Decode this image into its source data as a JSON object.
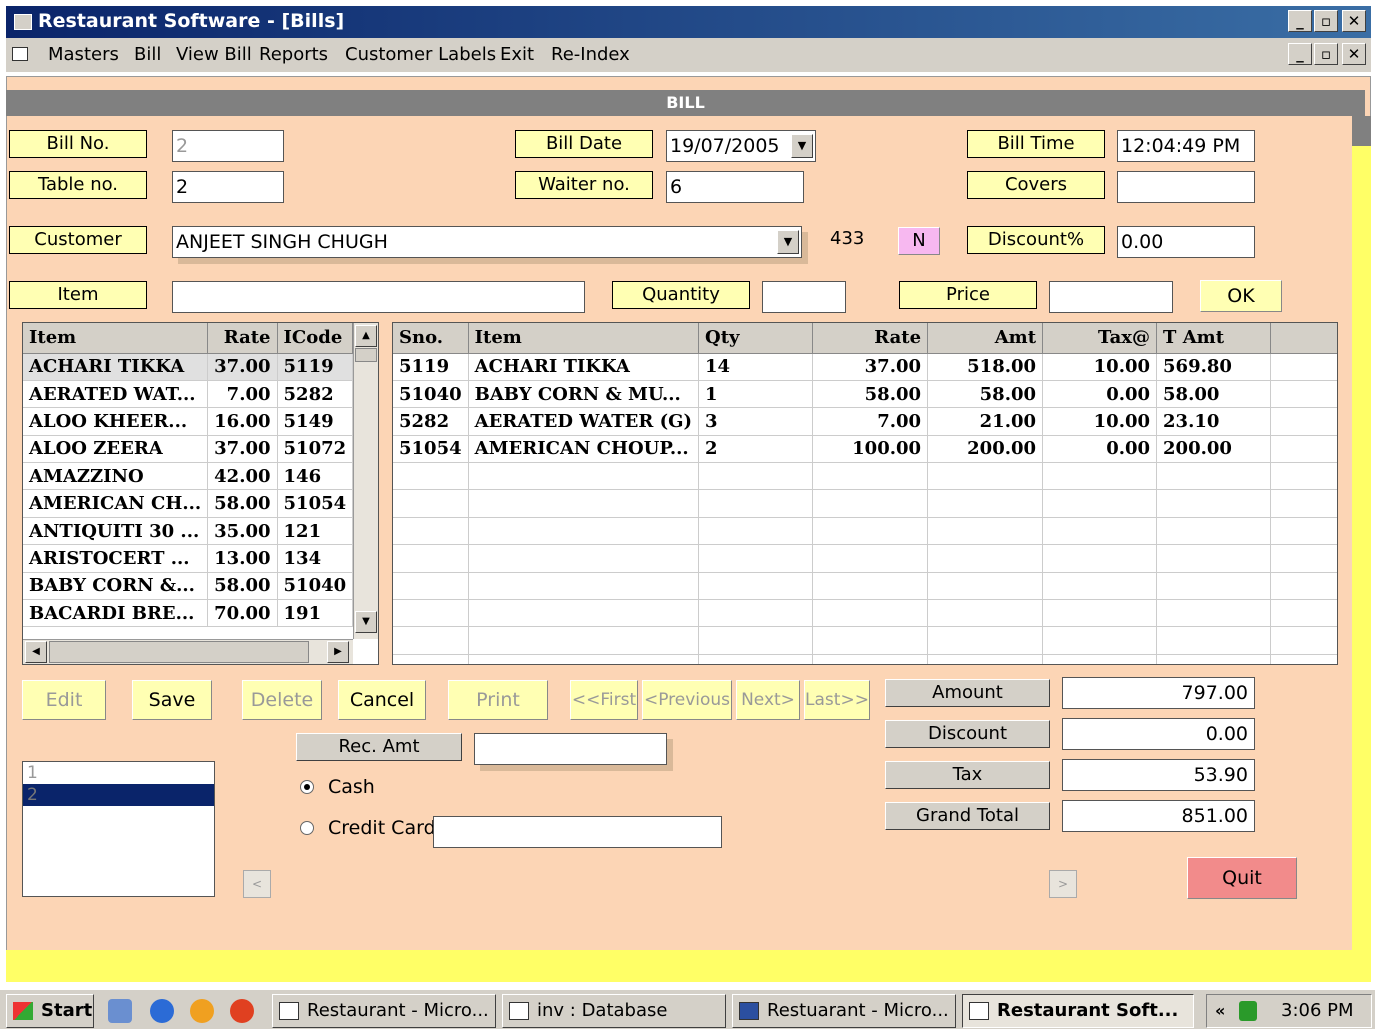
{
  "window": {
    "title": "Restaurant Software - [Bills]"
  },
  "menu": [
    "Masters",
    "Bill",
    "View Bill",
    "Reports",
    "Customer Labels",
    "Exit",
    "Re-Index"
  ],
  "form": {
    "header": "BILL",
    "bill_no": {
      "label": "Bill No.",
      "value": "2"
    },
    "table_no": {
      "label": "Table no.",
      "value": "2"
    },
    "bill_date": {
      "label": "Bill Date",
      "value": "19/07/2005"
    },
    "waiter_no": {
      "label": "Waiter no.",
      "value": "6"
    },
    "bill_time": {
      "label": "Bill Time",
      "value": "12:04:49 PM"
    },
    "covers": {
      "label": "Covers",
      "value": ""
    },
    "customer": {
      "label": "Customer",
      "value": "ANJEET SINGH CHUGH",
      "code": "433",
      "new_btn": "N"
    },
    "discount_pct": {
      "label": "Discount%",
      "value": "0.00"
    },
    "item": {
      "label": "Item",
      "value": ""
    },
    "quantity": {
      "label": "Quantity",
      "value": ""
    },
    "price": {
      "label": "Price",
      "value": ""
    },
    "ok_btn": "OK"
  },
  "menu_grid": {
    "columns": [
      "Item",
      "Rate",
      "ICode"
    ],
    "rows": [
      [
        "ACHARI TIKKA",
        "37.00",
        "5119"
      ],
      [
        "AERATED WAT...",
        "7.00",
        "5282"
      ],
      [
        "ALOO KHEER...",
        "16.00",
        "5149"
      ],
      [
        "ALOO ZEERA",
        "37.00",
        "51072"
      ],
      [
        "AMAZZINO",
        "42.00",
        "146"
      ],
      [
        "AMERICAN CH...",
        "58.00",
        "51054"
      ],
      [
        "ANTIQUITI 30 ...",
        "35.00",
        "121"
      ],
      [
        "ARISTOCERT ...",
        "13.00",
        "134"
      ],
      [
        "BABY CORN &...",
        "58.00",
        "51040"
      ],
      [
        "BACARDI BRE...",
        "70.00",
        "191"
      ]
    ]
  },
  "bill_grid": {
    "columns": [
      "Sno.",
      "Item",
      "Qty",
      "Rate",
      "Amt",
      "Tax@",
      "T Amt"
    ],
    "rows": [
      [
        "5119",
        "ACHARI TIKKA",
        "14",
        "37.00",
        "518.00",
        "10.00",
        "569.80"
      ],
      [
        "51040",
        "BABY CORN & MU...",
        "1",
        "58.00",
        "58.00",
        "0.00",
        "58.00"
      ],
      [
        "5282",
        "AERATED WATER (G)",
        "3",
        "7.00",
        "21.00",
        "10.00",
        "23.10"
      ],
      [
        "51054",
        "AMERICAN CHOUP...",
        "2",
        "100.00",
        "200.00",
        "0.00",
        "200.00"
      ]
    ],
    "empty_rows": 8
  },
  "buttons": {
    "edit": "Edit",
    "save": "Save",
    "delete": "Delete",
    "cancel": "Cancel",
    "print": "Print",
    "first": "<<First",
    "previous": "<Previous",
    "next": "Next>",
    "last": "Last>>",
    "quit": "Quit"
  },
  "payment": {
    "rec_amt_label": "Rec. Amt",
    "rec_amt_value": "",
    "cash": "Cash",
    "credit_card": "Credit Card",
    "card_value": "",
    "selected": "cash"
  },
  "bill_list": [
    "1",
    "2"
  ],
  "totals": {
    "amount": {
      "label": "Amount",
      "value": "797.00"
    },
    "discount": {
      "label": "Discount",
      "value": "0.00"
    },
    "tax": {
      "label": "Tax",
      "value": "53.90"
    },
    "grand_total": {
      "label": "Grand Total",
      "value": "851.00"
    }
  },
  "taskbar": {
    "start": "Start",
    "tasks": [
      "Restaurant - Micro...",
      "inv : Database",
      "Restuarant - Micro...",
      "Restaurant Soft..."
    ],
    "clock": "3:06 PM"
  },
  "colors": {
    "form_bg": "#fcd5b5",
    "label_bg": "#ffffb3",
    "quit_bg": "#f28b8b",
    "title_bar": "#0a246a",
    "new_btn": "#f7b8f0"
  }
}
